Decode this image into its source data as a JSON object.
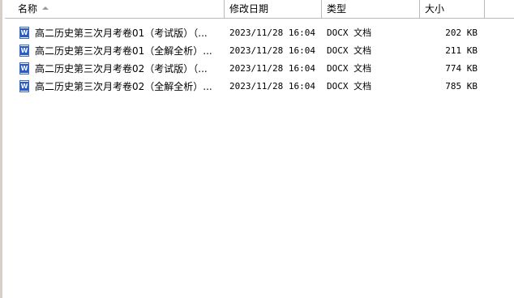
{
  "columns": {
    "name": "名称",
    "date": "修改日期",
    "type": "类型",
    "size": "大小"
  },
  "files": [
    {
      "name": "高二历史第三次月考卷01（考试版）（...",
      "date": "2023/11/28 16:04",
      "type": "DOCX 文档",
      "size": "202 KB",
      "icon": "word-doc-icon"
    },
    {
      "name": "高二历史第三次月考卷01（全解全析）...",
      "date": "2023/11/28 16:04",
      "type": "DOCX 文档",
      "size": "211 KB",
      "icon": "word-doc-icon"
    },
    {
      "name": "高二历史第三次月考卷02（考试版）（...",
      "date": "2023/11/28 16:04",
      "type": "DOCX 文档",
      "size": "774 KB",
      "icon": "word-doc-icon"
    },
    {
      "name": "高二历史第三次月考卷02（全解全析）...",
      "date": "2023/11/28 16:04",
      "type": "DOCX 文档",
      "size": "785 KB",
      "icon": "word-doc-icon"
    }
  ]
}
